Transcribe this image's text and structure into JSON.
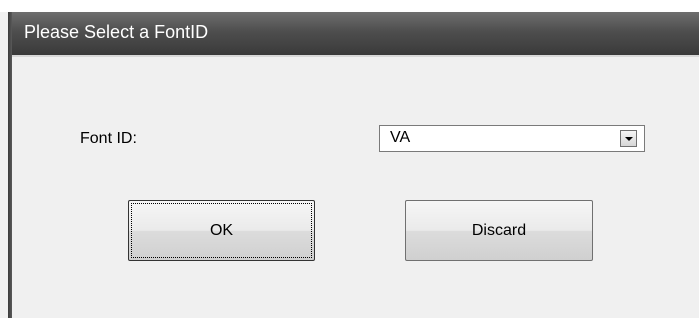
{
  "dialog": {
    "title": "Please Select a FontID",
    "font_label": "Font ID:",
    "font_select": {
      "selected": "VA"
    },
    "buttons": {
      "ok": "OK",
      "discard": "Discard"
    }
  }
}
